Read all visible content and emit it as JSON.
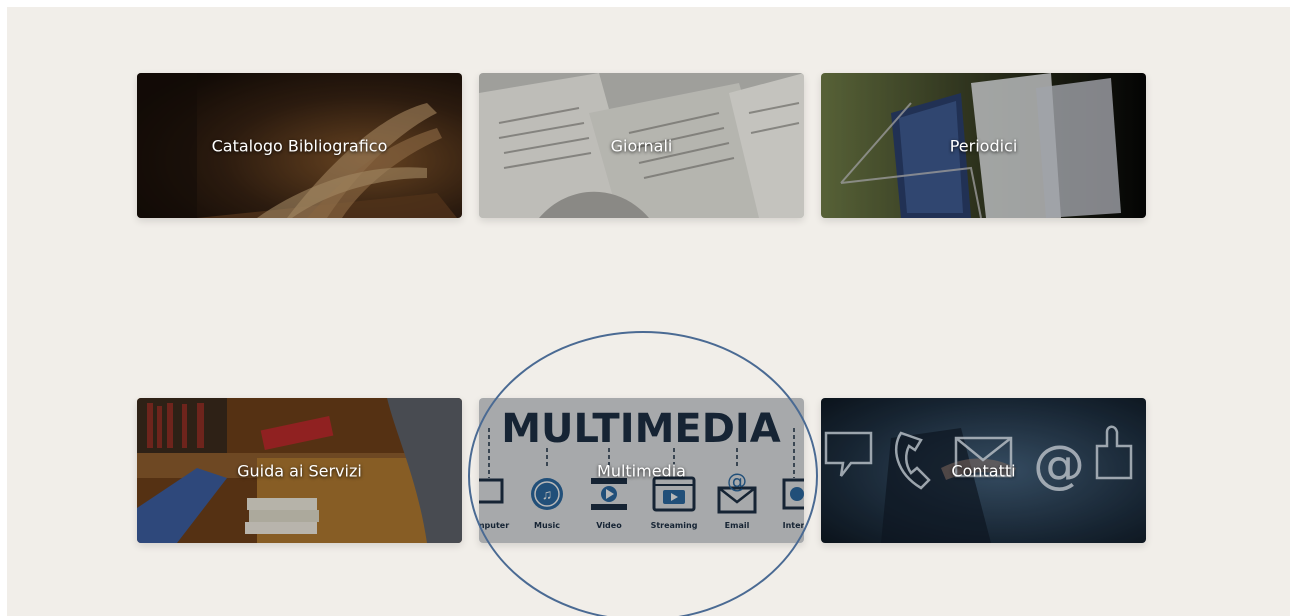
{
  "tiles": [
    {
      "label": "Catalogo Bibliografico"
    },
    {
      "label": "Giornali"
    },
    {
      "label": "Periodici"
    },
    {
      "label": "Guida ai Servizi"
    },
    {
      "label": "Multimedia"
    },
    {
      "label": "Contatti"
    }
  ],
  "multimedia_poster": {
    "heading": "MULTIMEDIA",
    "icons": [
      "Computer",
      "Music",
      "Video",
      "Streaming",
      "Email",
      "Internet"
    ]
  },
  "annotation": {
    "color": "#4a6a93"
  }
}
